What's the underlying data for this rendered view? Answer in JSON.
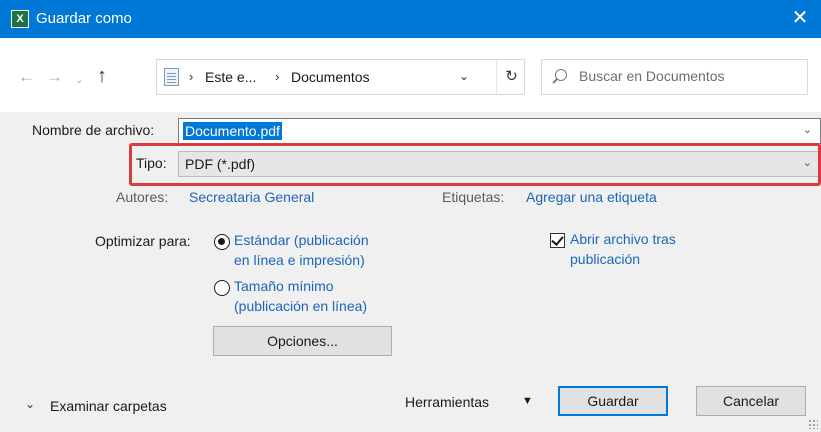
{
  "window": {
    "app_icon_letter": "X",
    "title": "Guardar como",
    "close_glyph": "✕"
  },
  "nav": {
    "back_glyph": "←",
    "forward_glyph": "→",
    "recent_glyph": "⌄",
    "up_glyph": "↑",
    "breadcrumb": [
      "Este e...",
      "Documentos"
    ],
    "breadcrumb_sep": "›",
    "address_dropdown_glyph": "⌄",
    "refresh_glyph": "↻",
    "search_placeholder": "Buscar en Documentos"
  },
  "form": {
    "filename_label": "Nombre de archivo:",
    "filename_value": "Documento.pdf",
    "filename_arrow": "⌄",
    "type_label": "Tipo:",
    "type_value": "PDF (*.pdf)",
    "type_arrow": "⌄",
    "authors_label": "Autores:",
    "authors_value": "Secreataria General",
    "tags_label": "Etiquetas:",
    "tags_value": "Agregar una etiqueta",
    "optimize_label": "Optimizar para:",
    "optimize_options": [
      {
        "line1": "Estándar (publicación",
        "line2": "en línea e impresión)",
        "selected": true
      },
      {
        "line1": "Tamaño mínimo",
        "line2": "(publicación en línea)",
        "selected": false
      }
    ],
    "open_after_line1": "Abrir archivo tras",
    "open_after_line2": "publicación",
    "open_after_checked": true,
    "options_button": "Opciones..."
  },
  "footer": {
    "browse_folders_chevron": "⌄",
    "browse_folders": "Examinar carpetas",
    "tools": "Herramientas",
    "tools_caret": "▼",
    "save": "Guardar",
    "cancel": "Cancelar"
  },
  "colors": {
    "titlebar": "#0078d7",
    "link": "#1c66b8",
    "highlight_border": "#d83b40",
    "selection": "#0078d7"
  }
}
